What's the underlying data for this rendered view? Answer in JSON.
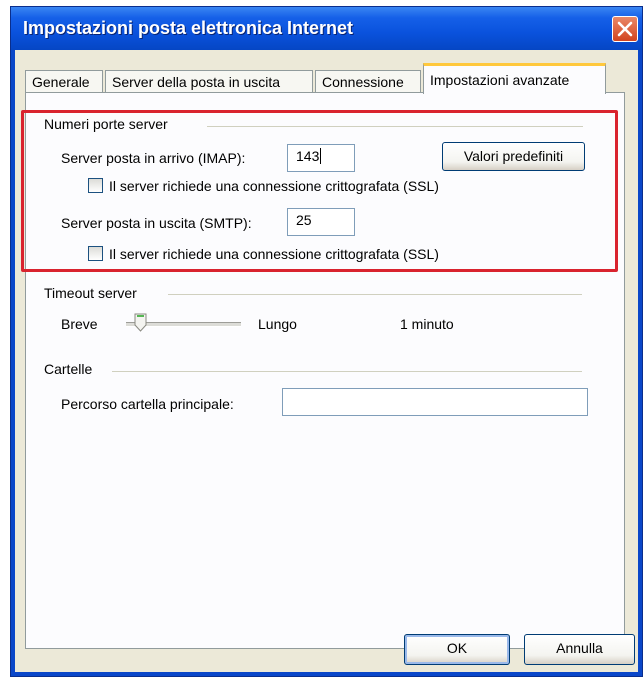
{
  "window": {
    "title": "Impostazioni posta elettronica Internet"
  },
  "tabs": [
    {
      "label": "Generale"
    },
    {
      "label": "Server della posta in uscita"
    },
    {
      "label": "Connessione"
    },
    {
      "label": "Impostazioni avanzate"
    }
  ],
  "active_tab": "Impostazioni avanzate",
  "server_ports": {
    "group_label": "Numeri porte server",
    "incoming_label": "Server posta in arrivo (IMAP):",
    "incoming_value": "143",
    "incoming_ssl_label": "Il server richiede una connessione crittografata (SSL)",
    "incoming_ssl_checked": false,
    "defaults_button": "Valori predefiniti",
    "outgoing_label": "Server posta in uscita (SMTP):",
    "outgoing_value": "25",
    "outgoing_ssl_label": "Il server richiede una connessione crittografata (SSL)",
    "outgoing_ssl_checked": false
  },
  "timeout": {
    "group_label": "Timeout server",
    "short_label": "Breve",
    "long_label": "Lungo",
    "value_text": "1 minuto",
    "slider_level": 0.08
  },
  "folders": {
    "group_label": "Cartelle",
    "root_path_label": "Percorso cartella principale:",
    "root_path_value": ""
  },
  "buttons": {
    "ok": "OK",
    "cancel": "Annulla"
  },
  "colors": {
    "highlight": "#d9232e",
    "titlebar": "#0a52dd",
    "active_tab_accent": "#ffc83c"
  }
}
